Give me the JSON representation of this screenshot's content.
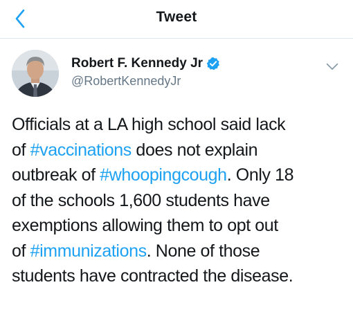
{
  "nav": {
    "title": "Tweet",
    "back_icon": "chevron-left-icon"
  },
  "colors": {
    "accent": "#1da1f2",
    "text": "#14171a",
    "secondary_text": "#657786",
    "divider": "#e1e8ed"
  },
  "tweet": {
    "author": {
      "name": "Robert F. Kennedy Jr",
      "handle": "@RobertKennedyJr",
      "verified": true,
      "verified_icon": "verified-badge-icon"
    },
    "more_icon": "chevron-down-icon",
    "body_lines": [
      [
        {
          "text": "Officials at a LA high school said lack",
          "type": "text"
        }
      ],
      [
        {
          "text": "of ",
          "type": "text"
        },
        {
          "text": "#vaccinations",
          "type": "hashtag"
        },
        {
          "text": " does not explain",
          "type": "text"
        }
      ],
      [
        {
          "text": "outbreak of ",
          "type": "text"
        },
        {
          "text": "#whoopingcough",
          "type": "hashtag"
        },
        {
          "text": ". Only 18",
          "type": "text"
        }
      ],
      [
        {
          "text": "of the schools 1,600 students have",
          "type": "text"
        }
      ],
      [
        {
          "text": "exemptions allowing them to opt out",
          "type": "text"
        }
      ],
      [
        {
          "text": "of ",
          "type": "text"
        },
        {
          "text": "#immunizations",
          "type": "hashtag"
        },
        {
          "text": ". None of those",
          "type": "text"
        }
      ],
      [
        {
          "text": "students have contracted the disease.",
          "type": "text"
        }
      ]
    ]
  }
}
